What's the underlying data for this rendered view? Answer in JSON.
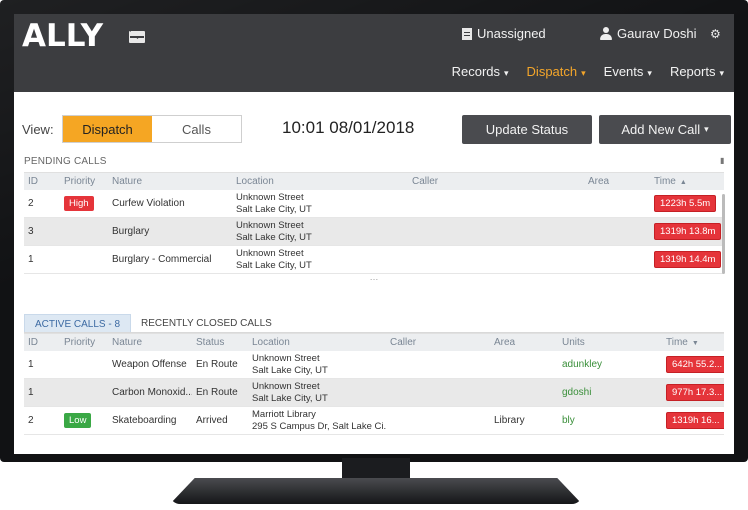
{
  "header": {
    "logo": "ALLY",
    "unassigned": "Unassigned",
    "user_name": "Gaurav Doshi",
    "nav": [
      {
        "label": "Records"
      },
      {
        "label": "Dispatch"
      },
      {
        "label": "Events"
      },
      {
        "label": "Reports"
      }
    ],
    "active_nav": "Dispatch",
    "accent_color": "#f4a62a"
  },
  "toolbar": {
    "view_label": "View:",
    "view_options": [
      "Dispatch",
      "Calls"
    ],
    "selected_view": "Dispatch",
    "datetime": "10:01 08/01/2018",
    "update_status_label": "Update Status",
    "add_new_call_label": "Add New Call"
  },
  "pending": {
    "title": "PENDING CALLS",
    "columns": [
      "ID",
      "Priority",
      "Nature",
      "Location",
      "Caller",
      "Area",
      "Time"
    ],
    "rows": [
      {
        "id": "2",
        "priority": "High",
        "nature": "Curfew Violation",
        "loc1": "Unknown Street",
        "loc2": "Salt Lake City, UT",
        "caller": "",
        "area": "",
        "time": "1223h 5.5m"
      },
      {
        "id": "3",
        "priority": "",
        "nature": "Burglary",
        "loc1": "Unknown Street",
        "loc2": "Salt Lake City, UT",
        "caller": "",
        "area": "",
        "time": "1319h 13.8m"
      },
      {
        "id": "1",
        "priority": "",
        "nature": "Burglary - Commercial",
        "loc1": "Unknown Street",
        "loc2": "Salt Lake City, UT",
        "caller": "",
        "area": "",
        "time": "1319h 14.4m"
      }
    ]
  },
  "active": {
    "tabs": [
      "ACTIVE CALLS - 8",
      "RECENTLY CLOSED CALLS"
    ],
    "columns": [
      "ID",
      "Priority",
      "Nature",
      "Status",
      "Location",
      "Caller",
      "Area",
      "Units",
      "Time"
    ],
    "rows": [
      {
        "id": "1",
        "priority": "",
        "nature": "Weapon Offense",
        "status": "En Route",
        "loc1": "Unknown Street",
        "loc2": "Salt Lake City, UT",
        "caller": "",
        "area": "",
        "units": "adunkley",
        "time": "642h 55.2..."
      },
      {
        "id": "1",
        "priority": "",
        "nature": "Carbon Monoxid...",
        "status": "En Route",
        "loc1": "Unknown Street",
        "loc2": "Salt Lake City, UT",
        "caller": "",
        "area": "",
        "units": "gdoshi",
        "time": "977h 17.3..."
      },
      {
        "id": "2",
        "priority": "Low",
        "nature": "Skateboarding",
        "status": "Arrived",
        "loc1": "Marriott Library",
        "loc2": "295 S Campus Dr, Salt Lake Ci...",
        "caller": "",
        "area": "Library",
        "units": "bly",
        "time": "1319h 16..."
      }
    ]
  },
  "colors": {
    "header_bg": "#3c3d40",
    "high": "#e5343a",
    "low": "#3aa845",
    "time_badge": "#e5343a"
  }
}
